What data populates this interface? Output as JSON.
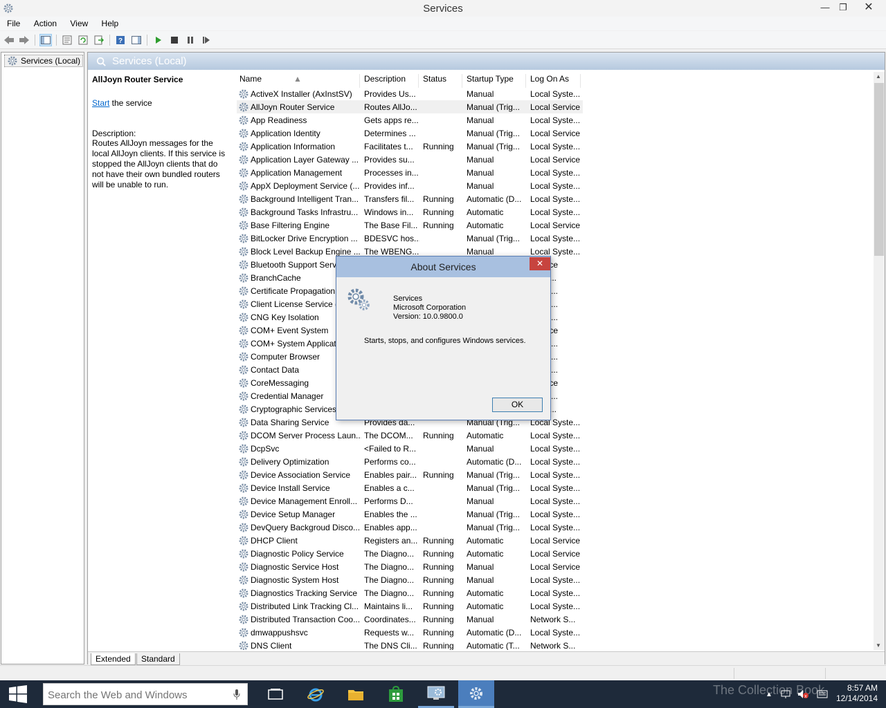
{
  "window": {
    "title": "Services",
    "min_glyph": "—",
    "max_glyph": "❐",
    "close_glyph": "✕"
  },
  "menu": [
    "File",
    "Action",
    "View",
    "Help"
  ],
  "toolbar": {
    "icons": [
      "back-icon",
      "forward-icon",
      "show-hide-console-tree-icon",
      "properties-icon",
      "refresh-icon",
      "export-list-icon",
      "help-icon",
      "action-pane-icon",
      "start-service-icon",
      "stop-service-icon",
      "pause-service-icon",
      "restart-service-icon"
    ]
  },
  "tree": {
    "root_label": "Services (Local)"
  },
  "pane": {
    "header_title": "Services (Local)",
    "selected_service": "AllJoyn Router Service",
    "start_link": "Start",
    "start_suffix": " the service",
    "description_label": "Description:",
    "description_text": "Routes AllJoyn messages for the local AllJoyn clients. If this service is stopped the AllJoyn clients that do not have their own bundled routers will be unable to run."
  },
  "columns": [
    "Name",
    "Description",
    "Status",
    "Startup Type",
    "Log On As"
  ],
  "services": [
    [
      "ActiveX Installer (AxInstSV)",
      "Provides Us...",
      "",
      "Manual",
      "Local Syste..."
    ],
    [
      "AllJoyn Router Service",
      "Routes AllJo...",
      "",
      "Manual (Trig...",
      "Local Service"
    ],
    [
      "App Readiness",
      "Gets apps re...",
      "",
      "Manual",
      "Local Syste..."
    ],
    [
      "Application Identity",
      "Determines ...",
      "",
      "Manual (Trig...",
      "Local Service"
    ],
    [
      "Application Information",
      "Facilitates t...",
      "Running",
      "Manual (Trig...",
      "Local Syste..."
    ],
    [
      "Application Layer Gateway ...",
      "Provides su...",
      "",
      "Manual",
      "Local Service"
    ],
    [
      "Application Management",
      "Processes in...",
      "",
      "Manual",
      "Local Syste..."
    ],
    [
      "AppX Deployment Service (...",
      "Provides inf...",
      "",
      "Manual",
      "Local Syste..."
    ],
    [
      "Background Intelligent Tran...",
      "Transfers fil...",
      "Running",
      "Automatic (D...",
      "Local Syste..."
    ],
    [
      "Background Tasks Infrastru...",
      "Windows in...",
      "Running",
      "Automatic",
      "Local Syste..."
    ],
    [
      "Base Filtering Engine",
      "The Base Fil...",
      "Running",
      "Automatic",
      "Local Service"
    ],
    [
      "BitLocker Drive Encryption ...",
      "BDESVC hos...",
      "",
      "Manual (Trig...",
      "Local Syste..."
    ],
    [
      "Block Level Backup Engine ...",
      "The WBENG...",
      "",
      "Manual",
      "Local Syste..."
    ],
    [
      "Bluetooth Support Servi",
      "",
      "",
      "",
      "Service"
    ],
    [
      "BranchCache",
      "",
      "",
      "",
      "ork S..."
    ],
    [
      "Certificate Propagation",
      "",
      "",
      "",
      "Syste..."
    ],
    [
      "Client License Service (C",
      "",
      "",
      "",
      "Syste..."
    ],
    [
      "CNG Key Isolation",
      "",
      "",
      "",
      "Syste..."
    ],
    [
      "COM+ Event System",
      "",
      "",
      "",
      "Service"
    ],
    [
      "COM+ System Applicat",
      "",
      "",
      "",
      "Syste..."
    ],
    [
      "Computer Browser",
      "",
      "",
      "",
      "Syste..."
    ],
    [
      "Contact Data",
      "",
      "",
      "",
      "Syste..."
    ],
    [
      "CoreMessaging",
      "",
      "",
      "",
      "Service"
    ],
    [
      "Credential Manager",
      "",
      "",
      "",
      "Syste..."
    ],
    [
      "Cryptographic Services",
      "",
      "",
      "",
      "ork S..."
    ],
    [
      "Data Sharing Service",
      "Provides da...",
      "",
      "Manual (Trig...",
      "Local Syste..."
    ],
    [
      "DCOM Server Process Laun...",
      "The DCOM...",
      "Running",
      "Automatic",
      "Local Syste..."
    ],
    [
      "DcpSvc",
      "<Failed to R...",
      "",
      "Manual",
      "Local Syste..."
    ],
    [
      "Delivery Optimization",
      "Performs co...",
      "",
      "Automatic (D...",
      "Local Syste..."
    ],
    [
      "Device Association Service",
      "Enables pair...",
      "Running",
      "Manual (Trig...",
      "Local Syste..."
    ],
    [
      "Device Install Service",
      "Enables a c...",
      "",
      "Manual (Trig...",
      "Local Syste..."
    ],
    [
      "Device Management Enroll...",
      "Performs D...",
      "",
      "Manual",
      "Local Syste..."
    ],
    [
      "Device Setup Manager",
      "Enables the ...",
      "",
      "Manual (Trig...",
      "Local Syste..."
    ],
    [
      "DevQuery Backgroud Disco...",
      "Enables app...",
      "",
      "Manual (Trig...",
      "Local Syste..."
    ],
    [
      "DHCP Client",
      "Registers an...",
      "Running",
      "Automatic",
      "Local Service"
    ],
    [
      "Diagnostic Policy Service",
      "The Diagno...",
      "Running",
      "Automatic",
      "Local Service"
    ],
    [
      "Diagnostic Service Host",
      "The Diagno...",
      "Running",
      "Manual",
      "Local Service"
    ],
    [
      "Diagnostic System Host",
      "The Diagno...",
      "Running",
      "Manual",
      "Local Syste..."
    ],
    [
      "Diagnostics Tracking Service",
      "The Diagno...",
      "Running",
      "Automatic",
      "Local Syste..."
    ],
    [
      "Distributed Link Tracking Cl...",
      "Maintains li...",
      "Running",
      "Automatic",
      "Local Syste..."
    ],
    [
      "Distributed Transaction Coo...",
      "Coordinates...",
      "Running",
      "Manual",
      "Network S..."
    ],
    [
      "dmwappushsvc",
      "Requests w...",
      "Running",
      "Automatic (D...",
      "Local Syste..."
    ],
    [
      "DNS Client",
      "The DNS Cli...",
      "Running",
      "Automatic (T...",
      "Network S..."
    ]
  ],
  "bottom_tabs": [
    "Extended",
    "Standard"
  ],
  "dialog": {
    "title": "About Services",
    "close_glyph": "✕",
    "product": "Services",
    "company": "Microsoft Corporation",
    "version": "Version: 10.0.9800.0",
    "blurb": "Starts, stops, and configures Windows services.",
    "ok_label": "OK"
  },
  "taskbar": {
    "search_placeholder": "Search the Web and Windows",
    "watermark": "The Collection Book",
    "time": "8:57 AM",
    "date": "12/14/2014"
  }
}
